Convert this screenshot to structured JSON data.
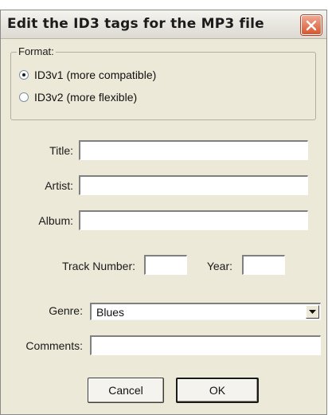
{
  "window": {
    "title": "Edit the ID3 tags for the MP3 file"
  },
  "format": {
    "label": "Format:",
    "options": [
      {
        "label": "ID3v1 (more compatible)",
        "checked": true
      },
      {
        "label": "ID3v2 (more flexible)",
        "checked": false
      }
    ]
  },
  "fields": {
    "title": {
      "label": "Title:",
      "value": ""
    },
    "artist": {
      "label": "Artist:",
      "value": ""
    },
    "album": {
      "label": "Album:",
      "value": ""
    },
    "track": {
      "label": "Track Number:",
      "value": ""
    },
    "year": {
      "label": "Year:",
      "value": ""
    },
    "genre": {
      "label": "Genre:",
      "value": "Blues"
    },
    "comments": {
      "label": "Comments:",
      "value": ""
    }
  },
  "buttons": {
    "cancel": "Cancel",
    "ok": "OK"
  },
  "icons": {
    "close": "close-icon",
    "dropdown": "chevron-down-icon"
  },
  "colors": {
    "dialog_bg": "#ece9d8",
    "close_button": "#d9572f"
  }
}
